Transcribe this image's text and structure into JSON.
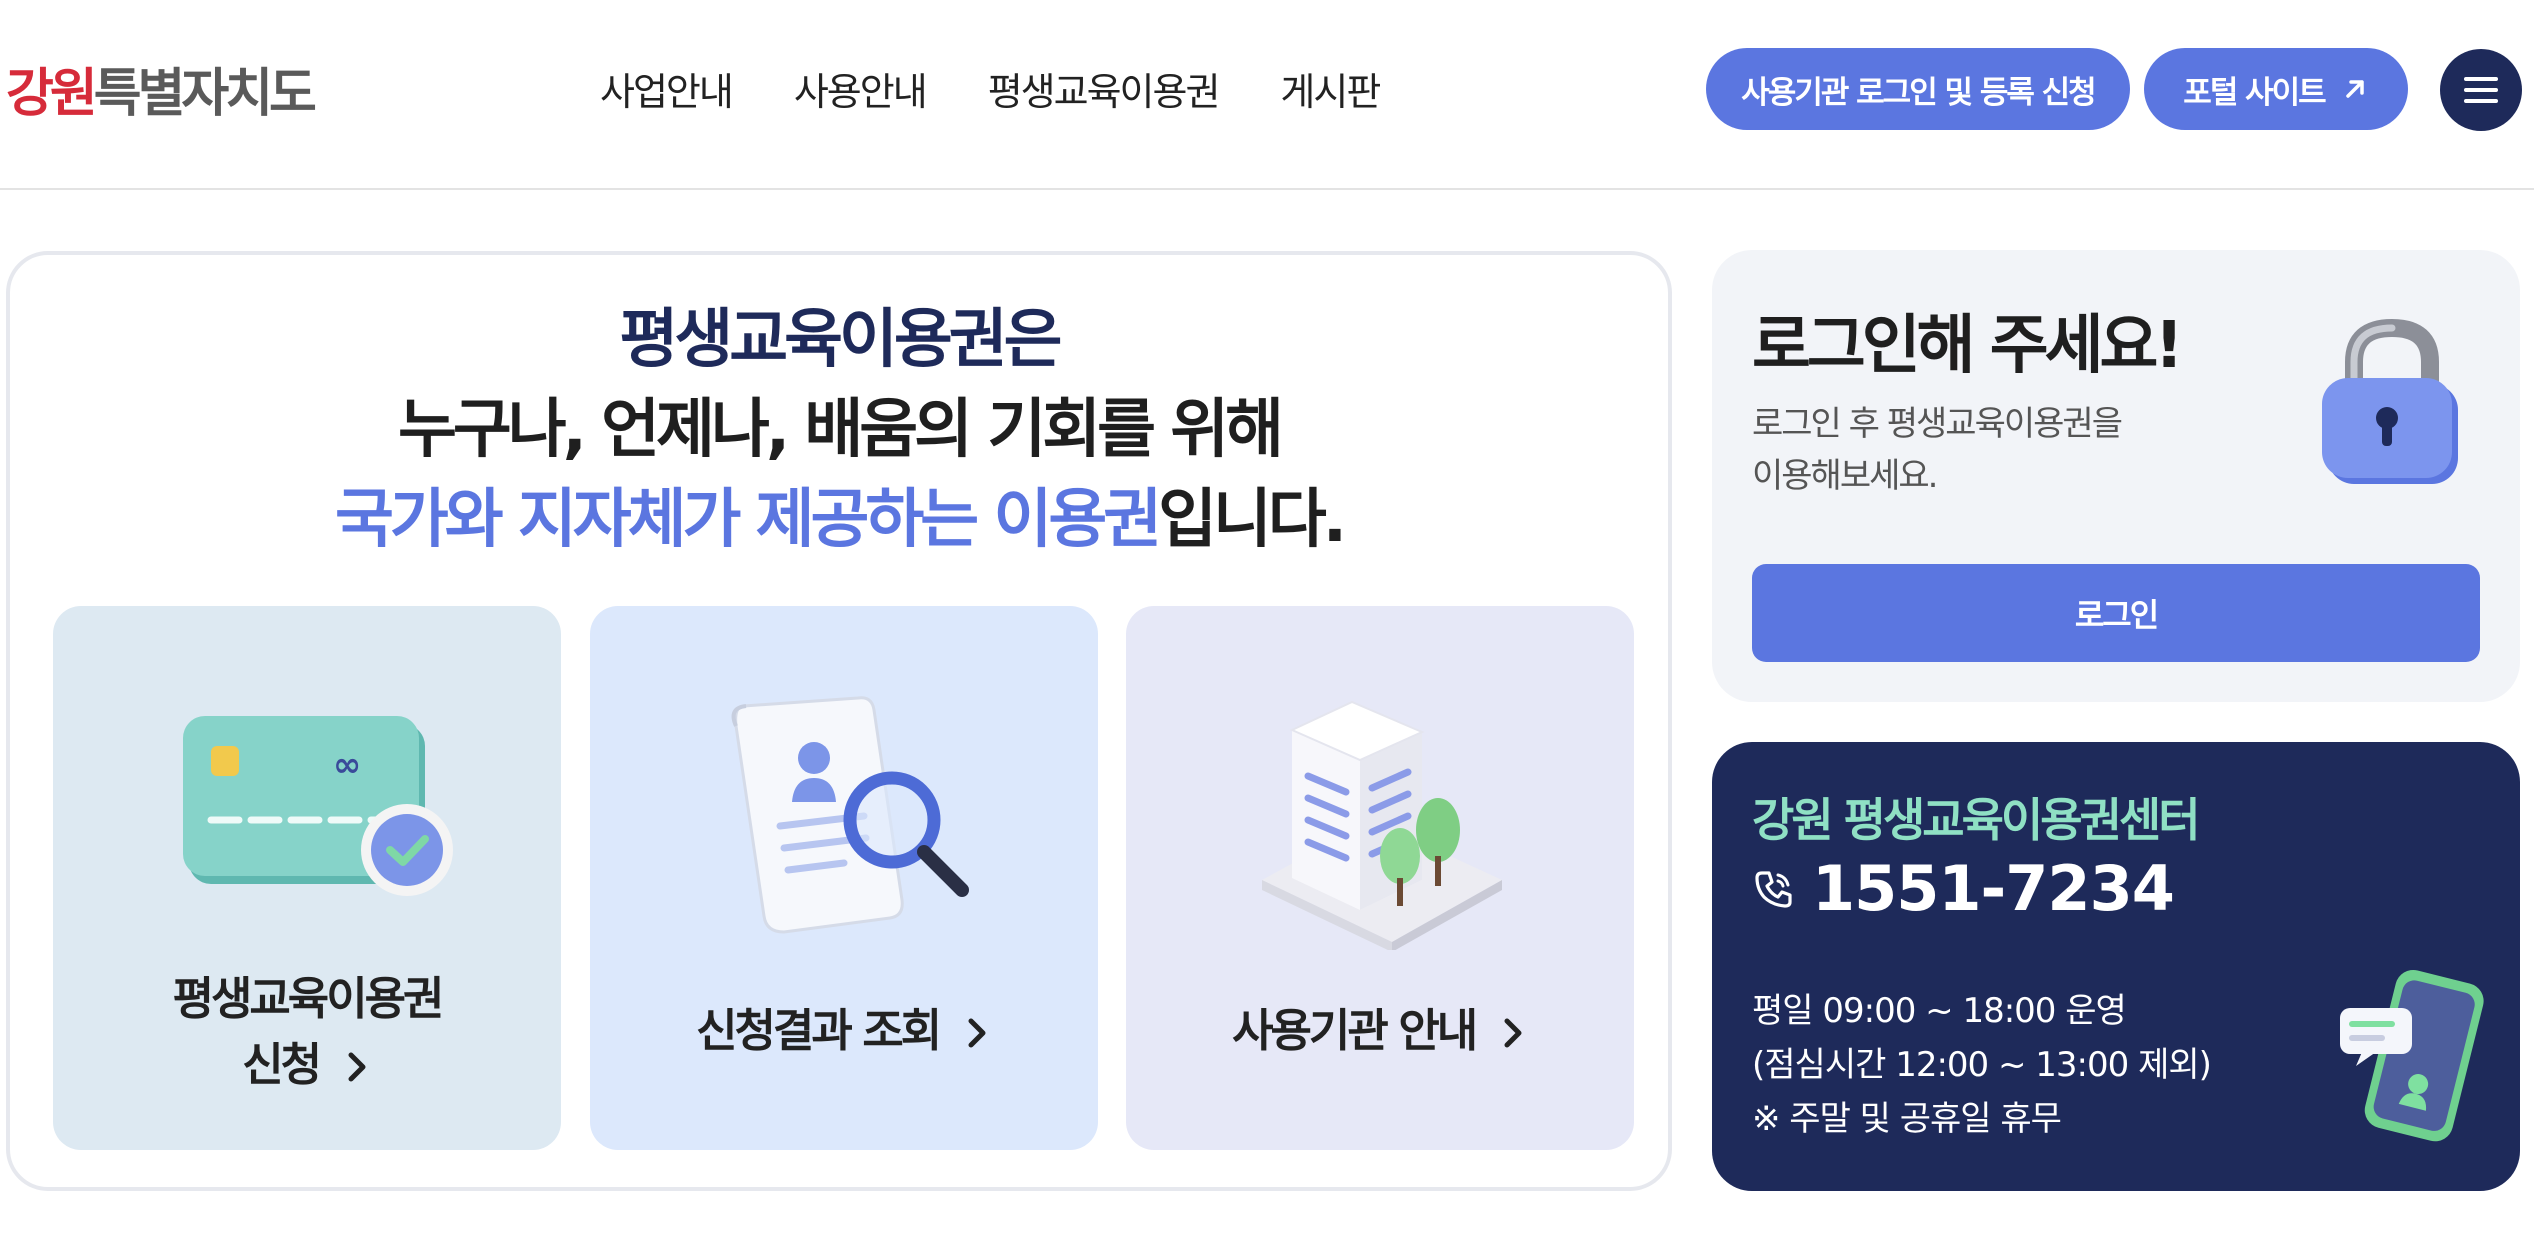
{
  "header": {
    "logo_mark": "강원",
    "logo_text": "특별자치도",
    "nav": [
      "사업안내",
      "사용안내",
      "평생교육이용권",
      "게시판"
    ],
    "org_login_button": "사용기관 로그인 및 등록 신청",
    "portal_button": "포털 사이트"
  },
  "intro": {
    "line1": "평생교육이용권은",
    "line2": "누구나, 언제나, 배움의 기회를 위해",
    "line3_highlight": "국가와 지자체가 제공하는 이용권",
    "line3_rest": "입니다.",
    "tiles": [
      {
        "line1": "평생교육이용권",
        "line2": "신청"
      },
      {
        "line1": "신청결과 조회"
      },
      {
        "line1": "사용기관 안내"
      }
    ]
  },
  "login": {
    "title": "로그인해 주세요!",
    "desc_line1": "로그인 후 평생교육이용권을",
    "desc_line2": "이용해보세요.",
    "button": "로그인"
  },
  "contact": {
    "title": "강원 평생교육이용권센터",
    "phone": "1551-7234",
    "hours_line1": "평일 09:00 ~ 18:00 운영",
    "hours_line2": "(점심시간 12:00 ~ 13:00 제외)",
    "hours_line3": "※ 주말 및 공휴일 휴무"
  },
  "colors": {
    "accent": "#5b76e0",
    "navy": "#1e2a5a",
    "mint": "#8fe0c4",
    "logo_red": "#d62b3a"
  },
  "icons": [
    "arrow-up-right-icon",
    "menu-icon",
    "card-check-icon",
    "document-search-icon",
    "building-icon",
    "lock-icon",
    "phone-icon",
    "smartphone-chat-icon",
    "chevron-right-icon"
  ]
}
